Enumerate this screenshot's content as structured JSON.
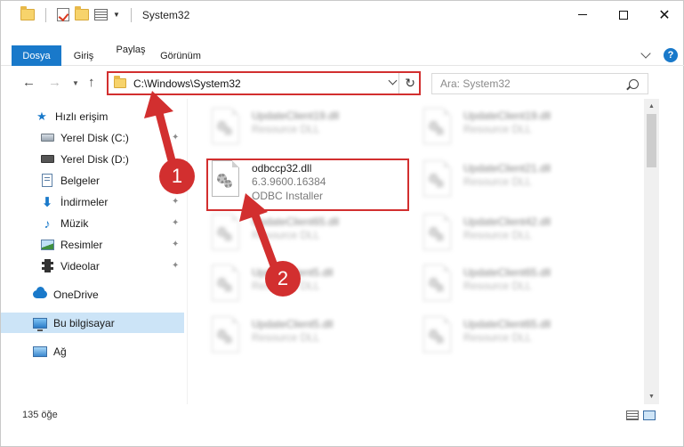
{
  "window": {
    "title": "System32",
    "close_glyph": "✕"
  },
  "ribbon": {
    "tabs": [
      "Dosya",
      "Giriş",
      "Paylaş",
      "Görünüm"
    ],
    "help_glyph": "?"
  },
  "address": {
    "path": "C:\\Windows\\System32",
    "refresh_glyph": "↻"
  },
  "nav": {
    "back_glyph": "←",
    "forward_glyph": "→",
    "recent_glyph": "▼",
    "up_glyph": "↑"
  },
  "search": {
    "placeholder": "Ara: System32"
  },
  "sidebar": {
    "items": [
      {
        "label": "Hızlı erişim",
        "icon": "star-icon"
      },
      {
        "label": "Yerel Disk (C:)",
        "icon": "drive-icon",
        "pinned": true
      },
      {
        "label": "Yerel Disk (D:)",
        "icon": "drive-icon"
      },
      {
        "label": "Belgeler",
        "icon": "documents-icon",
        "pinned": true
      },
      {
        "label": "İndirmeler",
        "icon": "download-icon",
        "pinned": true
      },
      {
        "label": "Müzik",
        "icon": "music-icon",
        "pinned": true
      },
      {
        "label": "Resimler",
        "icon": "pictures-icon",
        "pinned": true
      },
      {
        "label": "Videolar",
        "icon": "videos-icon",
        "pinned": true
      },
      {
        "label": "OneDrive",
        "icon": "cloud-icon"
      },
      {
        "label": "Bu bilgisayar",
        "icon": "computer-icon",
        "active": true
      },
      {
        "label": "Ağ",
        "icon": "network-icon"
      }
    ],
    "pin_glyph": "✦"
  },
  "files": {
    "highlighted": {
      "name": "odbccp32.dll",
      "version": "6.3.9600.16384",
      "description": "ODBC Installer"
    },
    "left_column": [
      {
        "name": "UpdateClient19.dll",
        "type": "Resource DLL"
      },
      {
        "name": "UpdateClient65.dll",
        "type": "Resource DLL"
      },
      {
        "name": "UpdateClient5.dll",
        "type": "Resource DLL"
      },
      {
        "name": "UpdateClient5.dll",
        "type": "Resource DLL"
      }
    ],
    "right_column": [
      {
        "name": "UpdateClient19.dll",
        "type": "Resource DLL"
      },
      {
        "name": "UpdateClient21.dll",
        "type": "Resource DLL"
      },
      {
        "name": "UpdateClient42.dll",
        "type": "Resource DLL"
      },
      {
        "name": "UpdateClient65.dll",
        "type": "Resource DLL"
      },
      {
        "name": "UpdateClient65.dll",
        "type": "Resource DLL"
      }
    ]
  },
  "scrollbar": {
    "up_glyph": "▲",
    "down_glyph": "▼"
  },
  "status": {
    "item_count": "135 öğe"
  },
  "annotations": {
    "step1": "1",
    "step2": "2",
    "accent_color": "#d22f2f"
  }
}
